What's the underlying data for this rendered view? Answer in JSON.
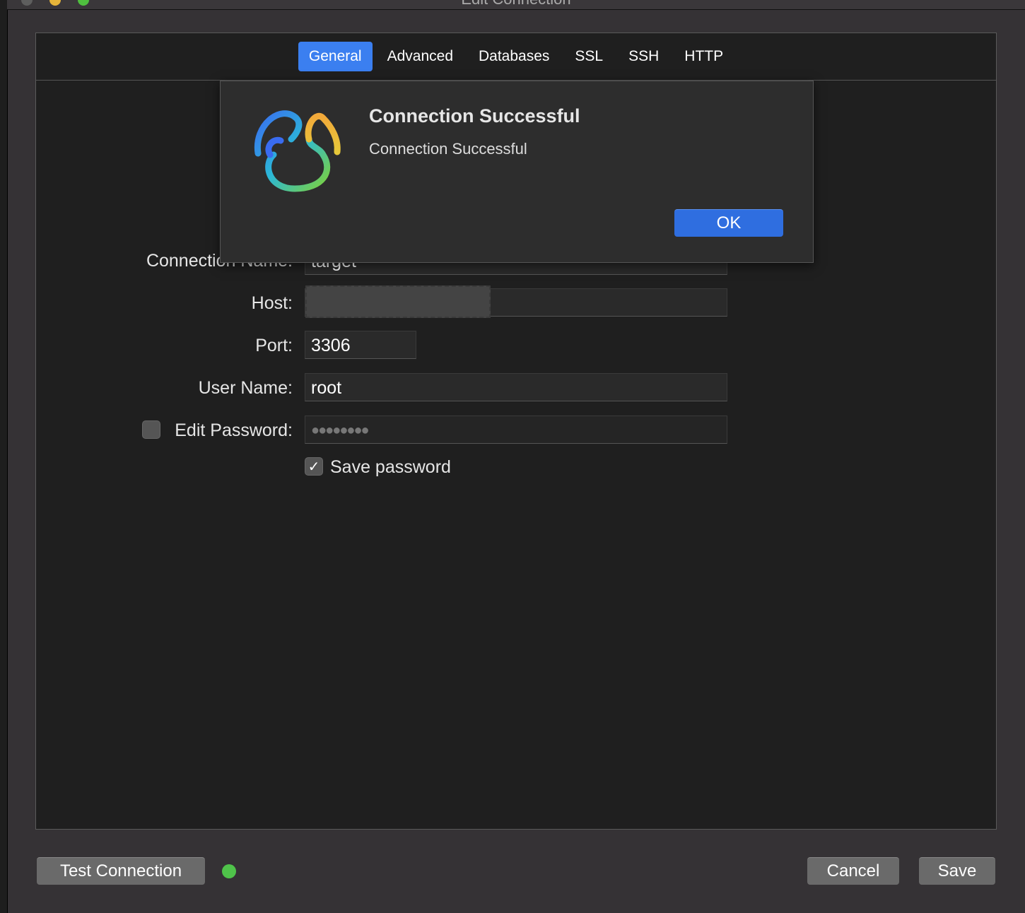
{
  "window": {
    "title": "Edit Connection"
  },
  "tabs": [
    {
      "label": "General",
      "active": true
    },
    {
      "label": "Advanced"
    },
    {
      "label": "Databases"
    },
    {
      "label": "SSL"
    },
    {
      "label": "SSH"
    },
    {
      "label": "HTTP"
    }
  ],
  "form": {
    "connection_name_label": "Connection Name:",
    "connection_name_value": "target",
    "host_label": "Host:",
    "host_value": "",
    "port_label": "Port:",
    "port_value": "3306",
    "user_label": "User Name:",
    "user_value": "root",
    "edit_password_label": "Edit Password:",
    "edit_password_checked": false,
    "password_mask": "●●●●●●●●",
    "save_password_label": "Save password",
    "save_password_checked": true
  },
  "dialog": {
    "title": "Connection Successful",
    "message": "Connection Successful",
    "ok_label": "OK",
    "icon": "navicat-logo"
  },
  "footer": {
    "test_connection_label": "Test Connection",
    "status_color": "#4fc34a",
    "cancel_label": "Cancel",
    "save_label": "Save"
  },
  "colors": {
    "accent": "#3b7ff0",
    "ok_button": "#2f6ee0"
  }
}
